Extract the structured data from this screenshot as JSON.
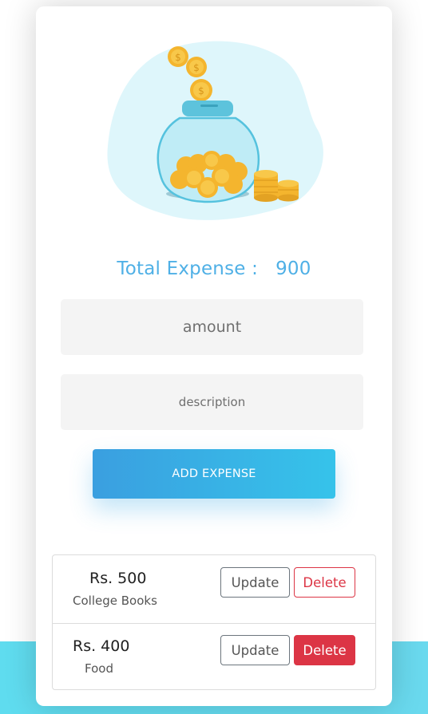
{
  "summary": {
    "total_label": "Total Expense :",
    "total_value": "900"
  },
  "form": {
    "amount_placeholder": "amount",
    "description_placeholder": "description",
    "submit_label": "ADD EXPENSE"
  },
  "expenses": [
    {
      "amount": "Rs. 500",
      "description": "College Books",
      "update_label": "Update",
      "delete_label": "Delete"
    },
    {
      "amount": "Rs. 400",
      "description": "Food",
      "update_label": "Update",
      "delete_label": "Delete"
    }
  ],
  "illustration": {
    "icon": "coin-jar-illustration"
  },
  "colors": {
    "accent": "#4fb0e6",
    "delete": "#dc3545",
    "bottom_band": "#5fdcef"
  }
}
